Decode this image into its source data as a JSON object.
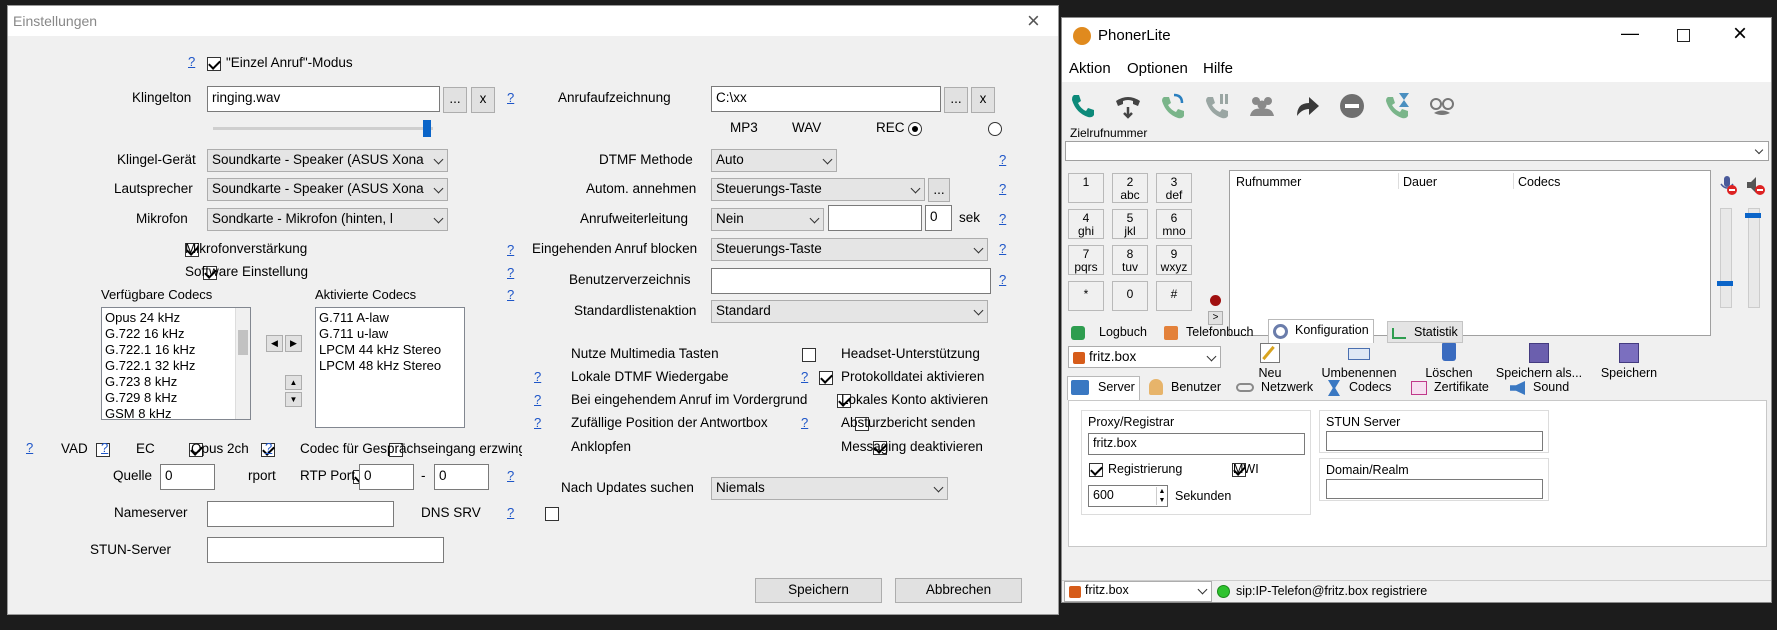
{
  "left_window": {
    "title": "Einstellungen",
    "einzel_anruf": "\"Einzel Anruf\"-Modus",
    "help": "?",
    "klingelton": {
      "label": "Klingelton",
      "value": "ringing.wav",
      "browse": "...",
      "clear": "x"
    },
    "klingel_geraet": {
      "label": "Klingel-Gerät",
      "value": "Soundkarte - Speaker (ASUS Xona"
    },
    "lautsprecher": {
      "label": "Lautsprecher",
      "value": "Soundkarte - Speaker (ASUS Xona"
    },
    "mikrofon": {
      "label": "Mikrofon",
      "value": "Sondkarte - Mikrofon (hinten, l"
    },
    "mikrofonverstaerkung": "Mikrofonverstärkung",
    "software_einstellung": "Software Einstellung",
    "verfuegbare_codecs": {
      "label": "Verfügbare Codecs",
      "items": [
        "Opus 24 kHz",
        "G.722 16 kHz",
        "G.722.1 16 kHz",
        "G.722.1 32 kHz",
        "G.723 8 kHz",
        "G.729 8 kHz",
        "GSM 8 kHz"
      ]
    },
    "aktivierte_codecs": {
      "label": "Aktivierte Codecs",
      "items": [
        "G.711 A-law",
        "G.711 u-law",
        "LPCM 44 kHz Stereo",
        "LPCM 48 kHz Stereo"
      ]
    },
    "vad": "VAD",
    "ec": "EC",
    "opus2ch": "Opus 2ch",
    "codec_gespraech": "Codec für Gesprächseingang erzwinge",
    "quelle": {
      "label": "Quelle",
      "value": "0"
    },
    "rport": "rport",
    "rtp_port": {
      "label": "RTP Port",
      "from": "0",
      "sep": "-",
      "to": "0"
    },
    "nameserver": {
      "label": "Nameserver",
      "value": ""
    },
    "dns_srv": "DNS SRV",
    "stun_server": {
      "label": "STUN-Server",
      "value": ""
    },
    "anrufaufzeichnung": {
      "label": "Anrufaufzeichnung",
      "value": "C:\\xx",
      "browse": "...",
      "clear": "x"
    },
    "mp3": "MP3",
    "wav": "WAV",
    "rec": "REC",
    "dtmf_methode": {
      "label": "DTMF Methode",
      "value": "Auto"
    },
    "autom_annehmen": {
      "label": "Autom. annehmen",
      "value": "Steuerungs-Taste",
      "more": "..."
    },
    "anrufweiterleitung": {
      "label": "Anrufweiterleitung",
      "value": "Nein",
      "target": "",
      "seconds": "0",
      "unit": "sek"
    },
    "eingehenden_blocken": {
      "label": "Eingehenden Anruf blocken",
      "value": "Steuerungs-Taste"
    },
    "benutzerverzeichnis": {
      "label": "Benutzerverzeichnis",
      "value": ""
    },
    "standardlistenaktion": {
      "label": "Standardlistenaktion",
      "value": "Standard"
    },
    "opt_multimedia": "Nutze Multimedia Tasten",
    "opt_dtmf": "Lokale DTMF Wiedergabe",
    "opt_vordergrund": "Bei eingehendem Anruf im Vordergrund",
    "opt_zufall": "Zufällige Position der Antwortbox",
    "opt_anklopfen": "Anklopfen",
    "opt_headset": "Headset-Unterstützung",
    "opt_protokoll": "Protokolldatei aktivieren",
    "opt_lokales": "Lokales Konto aktivieren",
    "opt_absturz": "Absturzbericht senden",
    "opt_messaging": "Messaging deaktivieren",
    "updates": {
      "label": "Nach Updates suchen",
      "value": "Niemals"
    },
    "speichern": "Speichern",
    "abbrechen": "Abbrechen"
  },
  "right_window": {
    "title": "PhonerLite",
    "menu": [
      "Aktion",
      "Optionen",
      "Hilfe"
    ],
    "zielrufnummer": "Zielrufnummer",
    "keypad": [
      {
        "d": "1",
        "l": ""
      },
      {
        "d": "2",
        "l": "abc"
      },
      {
        "d": "3",
        "l": "def"
      },
      {
        "d": "4",
        "l": "ghi"
      },
      {
        "d": "5",
        "l": "jkl"
      },
      {
        "d": "6",
        "l": "mno"
      },
      {
        "d": "7",
        "l": "pqrs"
      },
      {
        "d": "8",
        "l": "tuv"
      },
      {
        "d": "9",
        "l": "wxyz"
      },
      {
        "d": "*",
        "l": ""
      },
      {
        "d": "0",
        "l": ""
      },
      {
        "d": "#",
        "l": ""
      }
    ],
    "more_key": ">",
    "call_columns": [
      "Rufnummer",
      "Dauer",
      "Codecs"
    ],
    "tabs": [
      "Logbuch",
      "Telefonbuch",
      "Konfiguration",
      "Statistik"
    ],
    "profile": "fritz.box",
    "actions": [
      "Neu",
      "Umbenennen",
      "Löschen",
      "Speichern als...",
      "Speichern"
    ],
    "subtabs": [
      "Server",
      "Benutzer",
      "Netzwerk",
      "Codecs",
      "Zertifikate",
      "Sound"
    ],
    "proxy_label": "Proxy/Registrar",
    "proxy_value": "fritz.box",
    "registrierung": "Registrierung",
    "mwi": "MWI",
    "seconds_value": "600",
    "seconds_label": "Sekunden",
    "stun_label": "STUN Server",
    "domain_label": "Domain/Realm",
    "status_profile": "fritz.box",
    "status_text": "sip:IP-Telefon@fritz.box registriere",
    "colors": {
      "accent": "#1e56c8",
      "green": "#2e9d4f"
    }
  }
}
